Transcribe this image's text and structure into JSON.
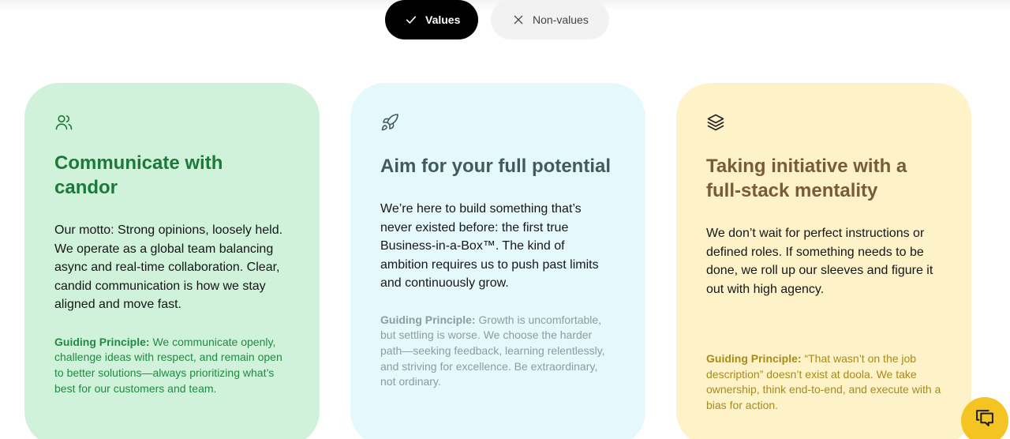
{
  "toggle": {
    "values_label": "Values",
    "nonvalues_label": "Non-values"
  },
  "cards": [
    {
      "icon": "users-icon",
      "title": "Communicate with candor",
      "body": "Our motto: Strong opinions, loosely held. We operate as a global team balancing async and real-time collaboration. Clear, candid communication is how we stay aligned and move fast.",
      "principle_label": "Guiding Principle:",
      "principle_text": " We communicate openly, challenge ideas with respect, and remain open to better solutions—always prioritizing what’s best for our customers and team."
    },
    {
      "icon": "rocket-icon",
      "title": "Aim for your full potential",
      "body": "We’re here to build something that’s never existed before: the first true Business-in-a-Box™. The kind of ambition requires us to push past limits and continuously grow.",
      "principle_label": "Guiding Principle:",
      "principle_text": " Growth is uncomfortable, but settling is worse. We choose the harder path—seeking feedback, learning relentlessly, and striving for excellence. Be extraordinary, not ordinary."
    },
    {
      "icon": "layers-icon",
      "title": "Taking initiative with a full-stack mentality",
      "body": "We don’t wait for perfect instructions or defined roles. If something needs to be done, we roll up our sleeves and figure it out with high agency.",
      "principle_label": "Guiding Principle:",
      "principle_text": " “That wasn’t on the job description” doesn’t exist at doola. We take ownership, think end-to-end, and execute with a bias for action."
    }
  ],
  "colors": {
    "green_card": "#d0f2da",
    "blue_card": "#e5f9fd",
    "yellow_card": "#fdf2c8",
    "chat_button": "#f4c422"
  },
  "chat": {
    "icon": "chat-bubbles-icon"
  }
}
